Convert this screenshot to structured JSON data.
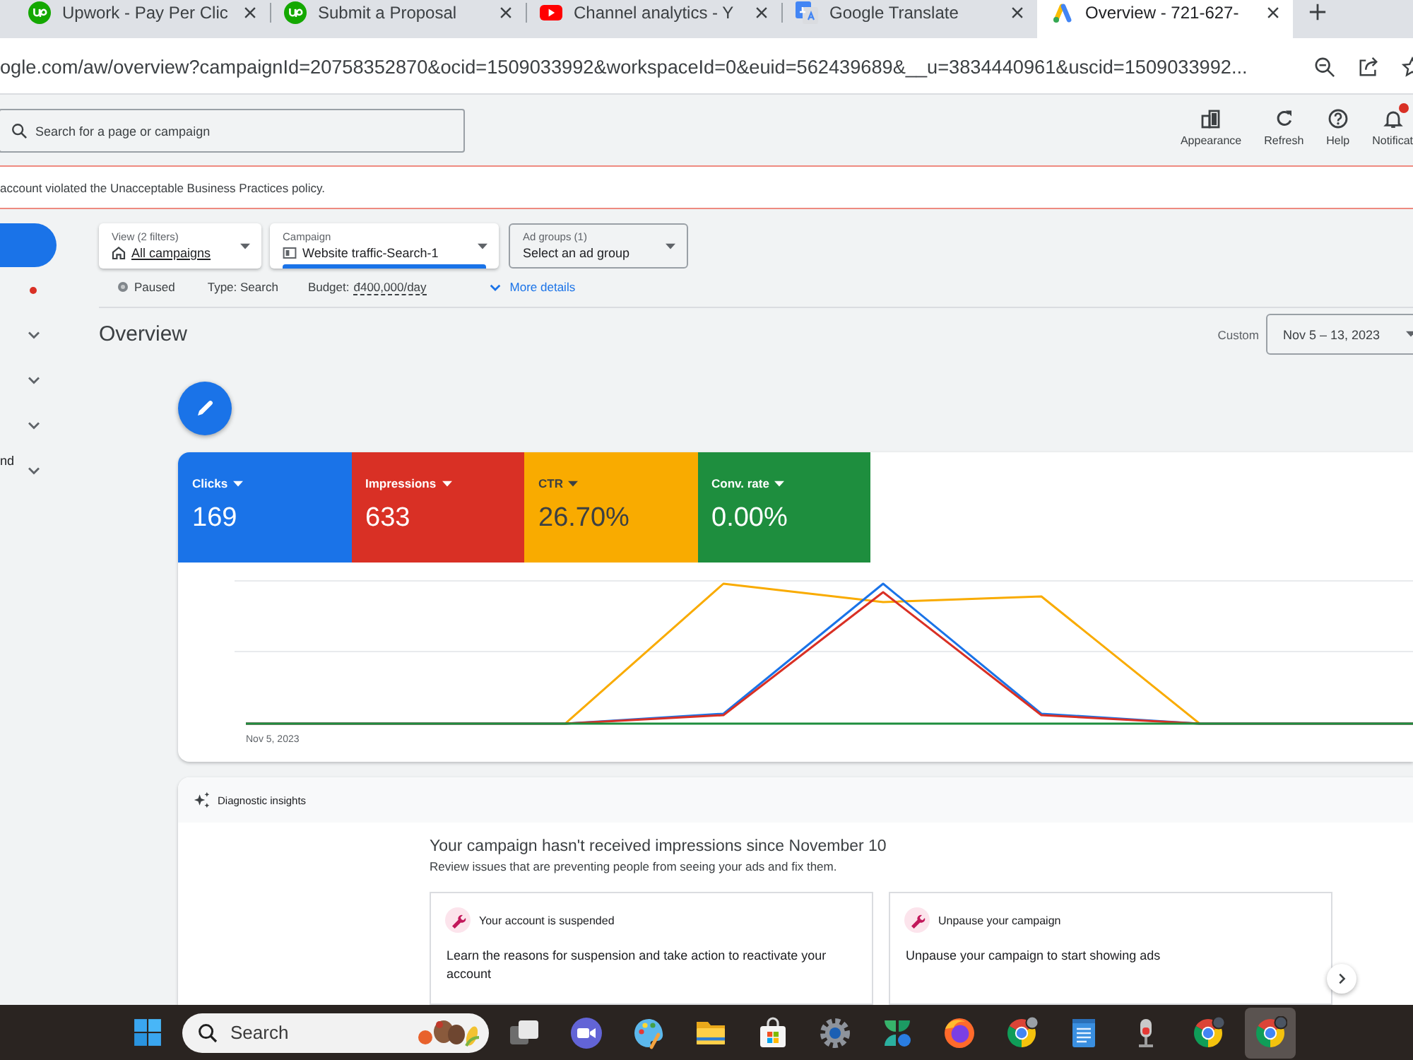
{
  "browser": {
    "tabs": [
      {
        "title": "Upwork - Pay Per Clic",
        "kind": "upwork",
        "selected": false
      },
      {
        "title": "Submit a Proposal",
        "kind": "upwork",
        "selected": false
      },
      {
        "title": "Channel analytics - Y",
        "kind": "youtube",
        "selected": false
      },
      {
        "title": "Google Translate",
        "kind": "translate",
        "selected": false
      },
      {
        "title": "Overview - 721-627-",
        "kind": "ads",
        "selected": true
      }
    ],
    "url": "ogle.com/aw/overview?campaignId=20758352870&ocid=1509033992&workspaceId=0&euid=562439689&__u=3834440961&uscid=1509033992..."
  },
  "ads_header": {
    "search": {
      "placeholder": "Search for a page or campaign"
    },
    "tools": [
      {
        "label": "Appearance",
        "kind": "appearance"
      },
      {
        "label": "Refresh",
        "kind": "refresh"
      },
      {
        "label": "Help",
        "kind": "help"
      },
      {
        "label": "Notificat",
        "kind": "notifications"
      }
    ]
  },
  "alert": {
    "text": "account violated the Unacceptable Business Practices policy."
  },
  "sidebar": {
    "items": [
      {
        "kind": "button"
      },
      {
        "kind": "dot"
      },
      {
        "kind": "group",
        "expanded": false
      },
      {
        "kind": "group",
        "expanded": false
      },
      {
        "kind": "group",
        "expanded": false
      },
      {
        "kind": "group",
        "label": "nd",
        "expanded": false
      }
    ]
  },
  "filters": [
    {
      "kind": "view",
      "label": "View (2 filters)",
      "value": "All campaigns",
      "selected": false
    },
    {
      "kind": "campaign",
      "label": "Campaign",
      "value": "Website traffic-Search-1",
      "selected": true
    },
    {
      "kind": "ad_group",
      "label": "Ad groups (1)",
      "value": "Select an ad group",
      "selected": false
    }
  ],
  "status": {
    "state": "Paused",
    "type": "Type: Search",
    "budget_label": "Budget:",
    "budget": "đ400,000/day",
    "more": "More details"
  },
  "overview": {
    "title": "Overview",
    "range_label": "Custom",
    "date_range": "Nov 5 – 13, 2023"
  },
  "metrics": [
    {
      "name": "Clicks",
      "value": "169",
      "color": "#1a73e8"
    },
    {
      "name": "Impressions",
      "value": "633",
      "color": "#d93025"
    },
    {
      "name": "CTR",
      "value": "26.70%",
      "color": "#f9ab00"
    },
    {
      "name": "Conv. rate",
      "value": "0.00%",
      "color": "#1e8e3e"
    }
  ],
  "chart": {
    "x_label": "Nov 5, 2023"
  },
  "insights": {
    "title": "Diagnostic insights",
    "headline": "Your campaign hasn't received impressions since November 10",
    "subtitle": "Review issues that are preventing people from seeing your ads and fix them.",
    "cards": [
      {
        "title": "Your account is suspended",
        "text": "Learn the reasons for suspension and take action to reactivate your account"
      },
      {
        "title": "Unpause your campaign",
        "text": "Unpause your campaign to start showing ads"
      }
    ]
  },
  "taskbar": {
    "search": {
      "placeholder": "Search"
    },
    "apps": [
      {
        "kind": "taskview",
        "selected": false
      },
      {
        "kind": "meet",
        "selected": false
      },
      {
        "kind": "paint",
        "selected": false
      },
      {
        "kind": "explorer",
        "selected": false
      },
      {
        "kind": "store",
        "selected": false
      },
      {
        "kind": "settings",
        "selected": false
      },
      {
        "kind": "widgets",
        "selected": false
      },
      {
        "kind": "firefox",
        "selected": false
      },
      {
        "kind": "chrome",
        "selected": false
      },
      {
        "kind": "notepad",
        "selected": false
      },
      {
        "kind": "recorder",
        "selected": false
      },
      {
        "kind": "chromeavatar",
        "selected": false
      },
      {
        "kind": "chromeavatar",
        "selected": true
      }
    ]
  }
}
